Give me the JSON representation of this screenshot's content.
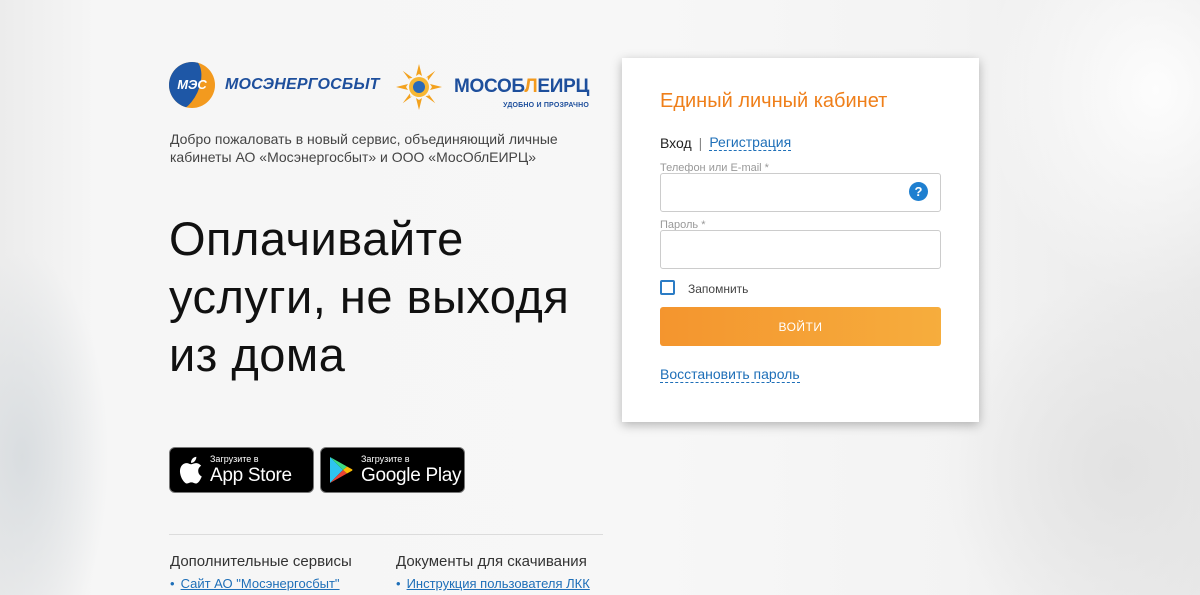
{
  "brand": {
    "mes_logo_text": "МЭС",
    "mes_name": "МОСЭНЕРГОСБЫТ",
    "mos_name_part1": "МОСОБ",
    "mos_name_part2": "Л",
    "mos_name_part3": "ЕИРЦ",
    "mos_tagline": "УДОБНО И ПРОЗРАЧНО",
    "orange": "#f39a1e",
    "blue": "#1e4f9c"
  },
  "welcome_text": "Добро пожаловать в новый сервис, объединяющий личные кабинеты АО «Мосэнергосбыт» и ООО «МосОблЕИРЦ»",
  "headline": {
    "line1": "Оплачивайте",
    "line2": "услуги, не выходя",
    "line3": "из дома"
  },
  "stores": {
    "apple": {
      "small": "Загрузите в",
      "big": "App Store",
      "icon": "apple-icon"
    },
    "google": {
      "small": "Загрузите в",
      "big": "Google Play",
      "icon": "google-play-icon"
    }
  },
  "footer": {
    "col1_title": "Дополнительные сервисы",
    "col1_link": "Сайт АО \"Мосэнергосбыт\"",
    "col2_title": "Документы для скачивания",
    "col2_link": "Инструкция пользователя ЛКК"
  },
  "login": {
    "title": "Единый личный кабинет",
    "tab_login": "Вход",
    "tab_separator": "|",
    "tab_register": "Регистрация",
    "phone_label": "Телефон или E-mail *",
    "phone_value": "",
    "password_label": "Пароль *",
    "password_value": "",
    "help_glyph": "?",
    "remember_label": "Запомнить",
    "submit_label": "ВОЙТИ",
    "restore_label": "Восстановить пароль",
    "accent": "#ef7f1a",
    "link_color": "#1e6fb8"
  }
}
